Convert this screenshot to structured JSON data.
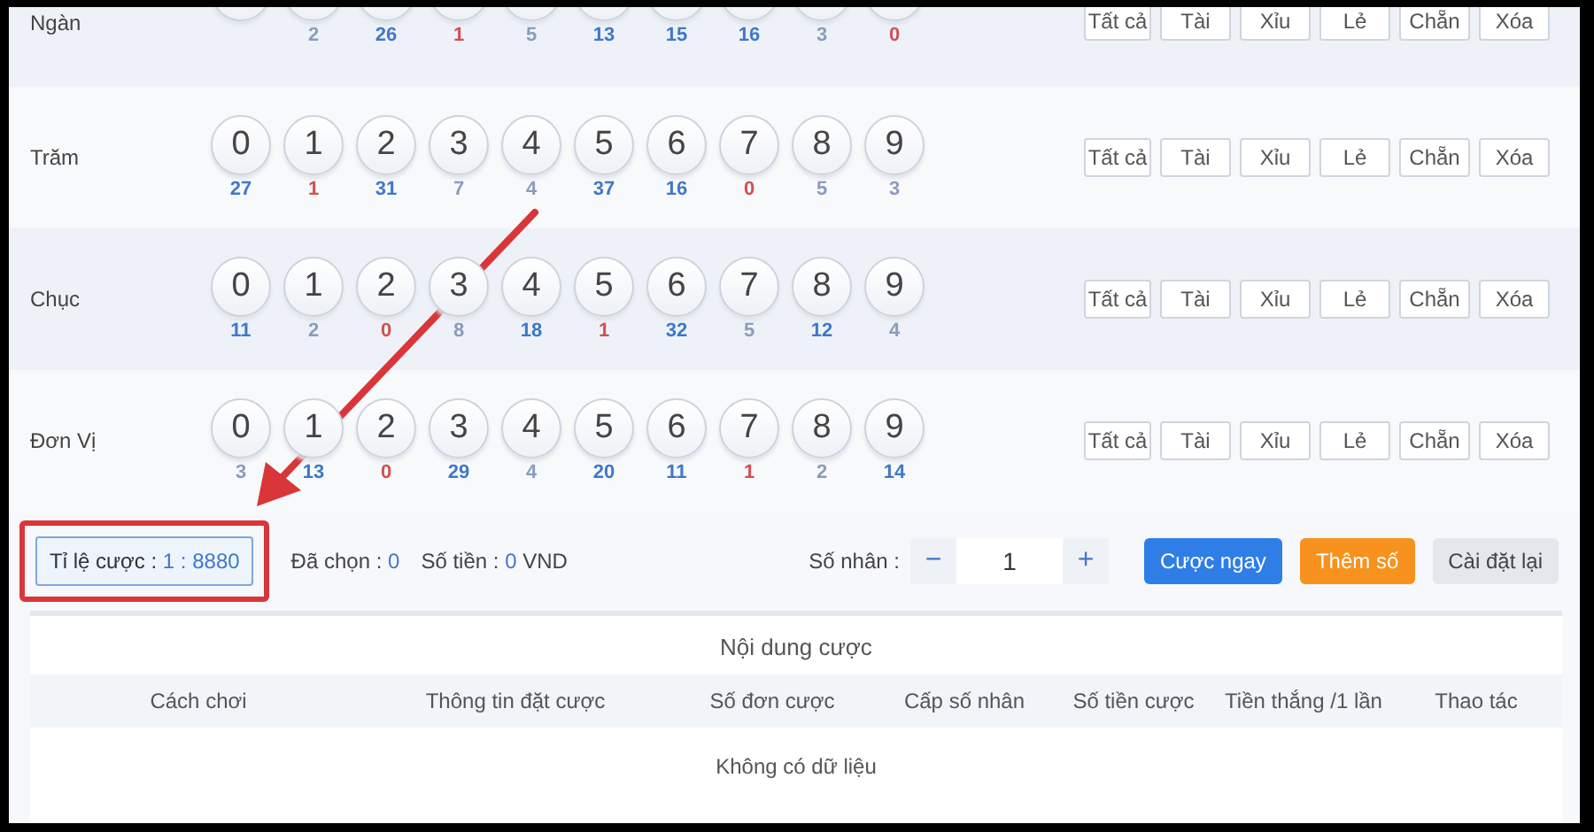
{
  "rows": [
    {
      "label": "Ngàn",
      "balls": [
        {
          "kind": "partial"
        },
        {
          "kind": "partial",
          "count": "2",
          "color": "#8a9cbc"
        },
        {
          "kind": "partial",
          "count": "26",
          "color": "#3f78c8"
        },
        {
          "kind": "partial",
          "count": "1",
          "color": "#d05050"
        },
        {
          "kind": "partial",
          "count": "5",
          "color": "#8a9cbc"
        },
        {
          "kind": "partial",
          "count": "13",
          "color": "#3f78c8"
        },
        {
          "kind": "partial",
          "count": "15",
          "color": "#3f78c8"
        },
        {
          "kind": "partial",
          "count": "16",
          "color": "#3f78c8"
        },
        {
          "kind": "partial",
          "count": "3",
          "color": "#8a9cbc"
        },
        {
          "kind": "partial",
          "count": "0",
          "color": "#d05050"
        }
      ],
      "quick": [
        "Tất cả",
        "Tài",
        "Xỉu",
        "Lẻ",
        "Chẵn",
        "Xóa"
      ]
    },
    {
      "label": "Trăm",
      "balls": [
        {
          "kind": "full",
          "digit": "0",
          "count": "27",
          "color": "#3f78c8"
        },
        {
          "kind": "full",
          "digit": "1",
          "count": "1",
          "color": "#d05050"
        },
        {
          "kind": "full",
          "digit": "2",
          "count": "31",
          "color": "#3f78c8"
        },
        {
          "kind": "full",
          "digit": "3",
          "count": "7",
          "color": "#8a9cbc"
        },
        {
          "kind": "full",
          "digit": "4",
          "count": "4",
          "color": "#8a9cbc"
        },
        {
          "kind": "full",
          "digit": "5",
          "count": "37",
          "color": "#3f78c8"
        },
        {
          "kind": "full",
          "digit": "6",
          "count": "16",
          "color": "#3f78c8"
        },
        {
          "kind": "full",
          "digit": "7",
          "count": "0",
          "color": "#d05050"
        },
        {
          "kind": "full",
          "digit": "8",
          "count": "5",
          "color": "#8a9cbc"
        },
        {
          "kind": "full",
          "digit": "9",
          "count": "3",
          "color": "#8a9cbc"
        }
      ],
      "quick": [
        "Tất cả",
        "Tài",
        "Xỉu",
        "Lẻ",
        "Chẵn",
        "Xóa"
      ]
    },
    {
      "label": "Chục",
      "balls": [
        {
          "kind": "full",
          "digit": "0",
          "count": "11",
          "color": "#3f78c8"
        },
        {
          "kind": "full",
          "digit": "1",
          "count": "2",
          "color": "#8a9cbc"
        },
        {
          "kind": "full",
          "digit": "2",
          "count": "0",
          "color": "#d05050"
        },
        {
          "kind": "full",
          "digit": "3",
          "count": "8",
          "color": "#8a9cbc"
        },
        {
          "kind": "full",
          "digit": "4",
          "count": "18",
          "color": "#3f78c8"
        },
        {
          "kind": "full",
          "digit": "5",
          "count": "1",
          "color": "#d05050"
        },
        {
          "kind": "full",
          "digit": "6",
          "count": "32",
          "color": "#3f78c8"
        },
        {
          "kind": "full",
          "digit": "7",
          "count": "5",
          "color": "#8a9cbc"
        },
        {
          "kind": "full",
          "digit": "8",
          "count": "12",
          "color": "#3f78c8"
        },
        {
          "kind": "full",
          "digit": "9",
          "count": "4",
          "color": "#8a9cbc"
        }
      ],
      "quick": [
        "Tất cả",
        "Tài",
        "Xỉu",
        "Lẻ",
        "Chẵn",
        "Xóa"
      ]
    },
    {
      "label": "Đơn Vị",
      "balls": [
        {
          "kind": "full",
          "digit": "0",
          "count": "3",
          "color": "#8a9cbc"
        },
        {
          "kind": "full",
          "digit": "1",
          "count": "13",
          "color": "#3f78c8"
        },
        {
          "kind": "full",
          "digit": "2",
          "count": "0",
          "color": "#d05050"
        },
        {
          "kind": "full",
          "digit": "3",
          "count": "29",
          "color": "#3f78c8"
        },
        {
          "kind": "full",
          "digit": "4",
          "count": "4",
          "color": "#8a9cbc"
        },
        {
          "kind": "full",
          "digit": "5",
          "count": "20",
          "color": "#3f78c8"
        },
        {
          "kind": "full",
          "digit": "6",
          "count": "11",
          "color": "#3f78c8"
        },
        {
          "kind": "full",
          "digit": "7",
          "count": "1",
          "color": "#d05050"
        },
        {
          "kind": "full",
          "digit": "8",
          "count": "2",
          "color": "#8a9cbc"
        },
        {
          "kind": "full",
          "digit": "9",
          "count": "14",
          "color": "#3f78c8"
        }
      ],
      "quick": [
        "Tất cả",
        "Tài",
        "Xỉu",
        "Lẻ",
        "Chẵn",
        "Xóa"
      ]
    }
  ],
  "summary": {
    "odds": {
      "label": "Tỉ lệ cược :",
      "value": "1 : 8880",
      "highlighted": true
    },
    "chosen": {
      "label": "Đã chọn :",
      "value": "0"
    },
    "amount": {
      "label": "Số tiền :",
      "value": "0",
      "unit": "VND"
    }
  },
  "multiplier": {
    "label": "Số nhân :",
    "minus": "−",
    "value": "1",
    "plus": "+"
  },
  "actions": [
    {
      "label": "Cược ngay",
      "kind": "primary"
    },
    {
      "label": "Thêm số",
      "kind": "warning"
    },
    {
      "label": "Cài đặt lại",
      "kind": "default"
    }
  ],
  "table": {
    "title": "Nội dung cược",
    "columns": [
      "Cách chơi",
      "Thông tin đặt cược",
      "Số đơn cược",
      "Cấp số nhân",
      "Số tiền cược",
      "Tiền thắng /1 lần",
      "Thao tác"
    ],
    "empty": "Không có dữ liệu"
  },
  "annotation": {
    "arrow": true
  }
}
